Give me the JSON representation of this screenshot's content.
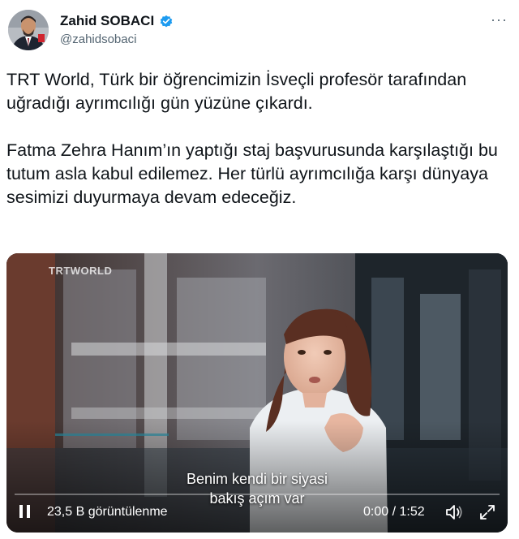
{
  "user": {
    "display_name": "Zahid SOBACI",
    "handle": "@zahidsobaci",
    "verified": true,
    "avatar_icon": "person-avatar"
  },
  "menu": {
    "more_label": "···"
  },
  "tweet": {
    "paragraph_1": "TRT World, Türk bir öğrencimizin İsveçli profesör tarafından uğradığı ayrımcılığı gün yüzüne çıkardı.",
    "paragraph_2": "Fatma Zehra Hanım’ın yaptığı staj başvurusunda karşılaştığı bu tutum asla kabul edilemez. Her türlü ayrımcılığa karşı dünyaya sesimizi duyurmaya devam edeceğiz."
  },
  "video": {
    "channel_logo": "TRTWORLD",
    "subtitle_line_1": "Benim kendi bir siyasi",
    "subtitle_line_2": "bakış açım var",
    "views": "23,5 B görüntülenme",
    "time": "0:00 / 1:52",
    "progress": 0,
    "icons": {
      "pause": "pause-icon",
      "volume": "volume-muted-icon",
      "fullscreen": "fullscreen-icon"
    }
  },
  "colors": {
    "accent_verified": "#1d9bf0",
    "text_primary": "#0f1419",
    "text_secondary": "#536471"
  }
}
